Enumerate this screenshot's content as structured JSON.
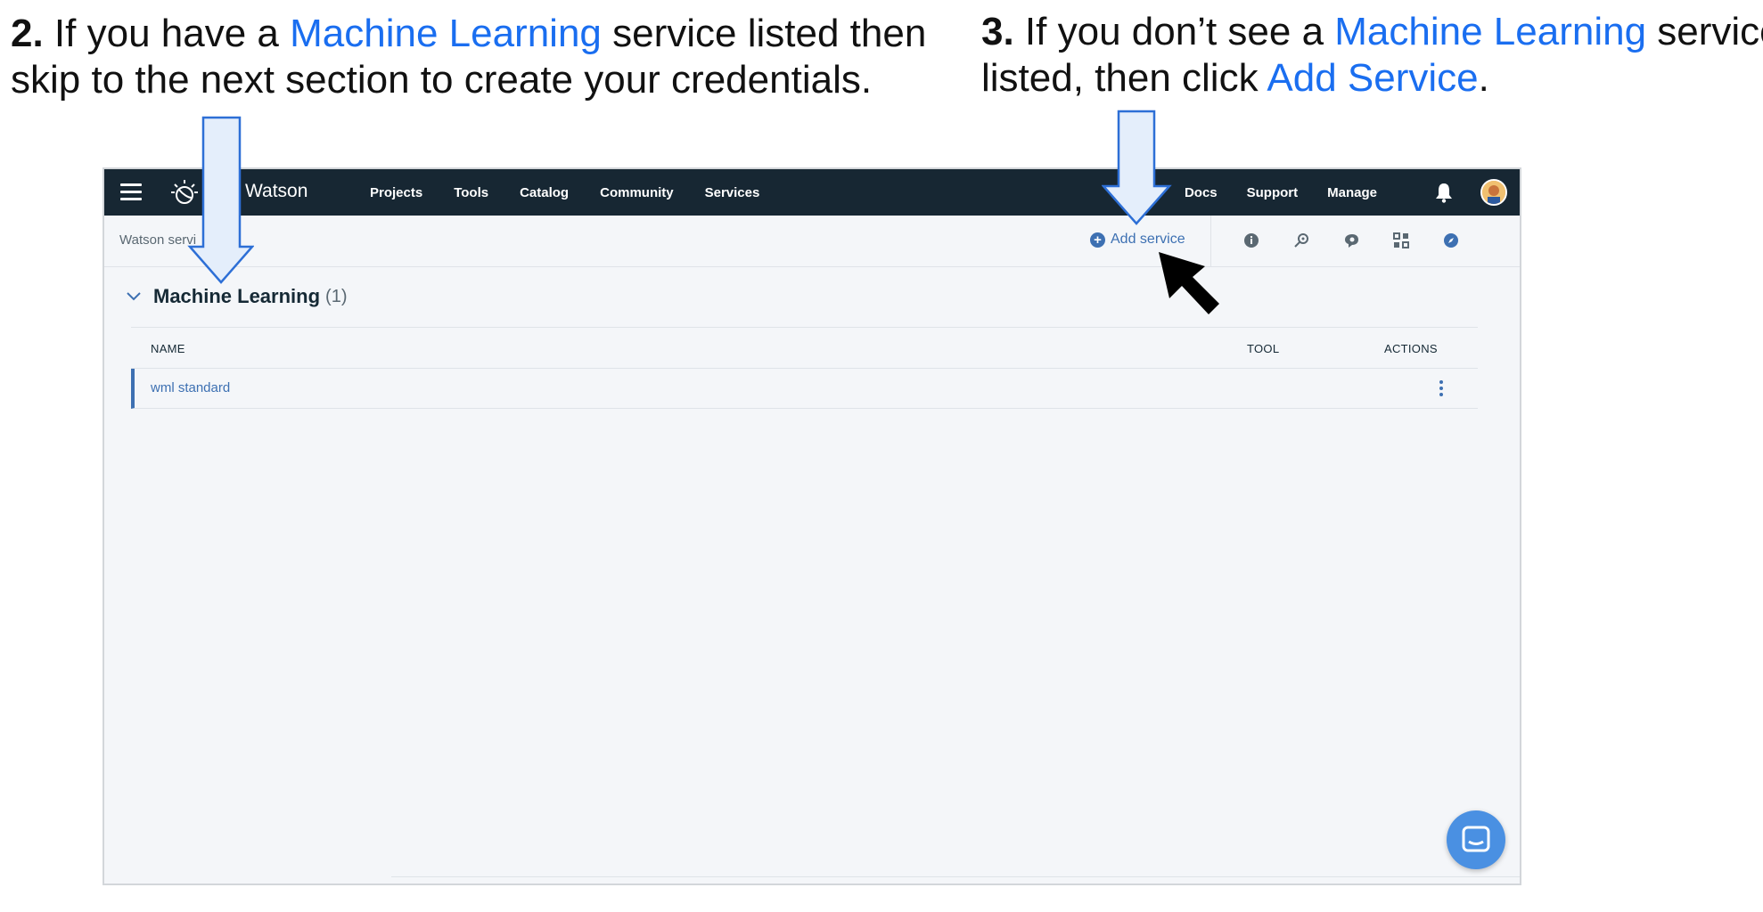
{
  "instructions": {
    "step2": {
      "number": "2.",
      "line1_pre": " If you have a ",
      "line1_highlight": "Machine Learning",
      "line1_post": " service listed then",
      "line2": "skip to the next section to create your credentials."
    },
    "step3": {
      "number": "3.",
      "line1_pre": " If you don’t see a ",
      "line1_highlight": "Machine Learning",
      "line1_post": " service",
      "line2_pre": "listed, then click ",
      "line2_highlight": "Add Service",
      "line2_post": "."
    },
    "highlight_color": "#1a6ef0"
  },
  "topnav": {
    "brand": "Watson",
    "links": [
      "Projects",
      "Tools",
      "Catalog",
      "Community",
      "Services"
    ],
    "right_links": [
      "Docs",
      "Support",
      "Manage"
    ],
    "background": "#172733"
  },
  "subbar": {
    "breadcrumb": "Watson servi",
    "add_service_label": "Add service",
    "icons": [
      "info-icon",
      "key-search-icon",
      "chat-icon",
      "apps-grid-icon",
      "compass-icon"
    ]
  },
  "section": {
    "title": "Machine Learning",
    "count": "(1)"
  },
  "table": {
    "headers": {
      "name": "NAME",
      "tool": "TOOL",
      "actions": "ACTIONS"
    },
    "rows": [
      {
        "name": "wml standard",
        "tool": ""
      }
    ]
  },
  "accent_color": "#3d70b2"
}
